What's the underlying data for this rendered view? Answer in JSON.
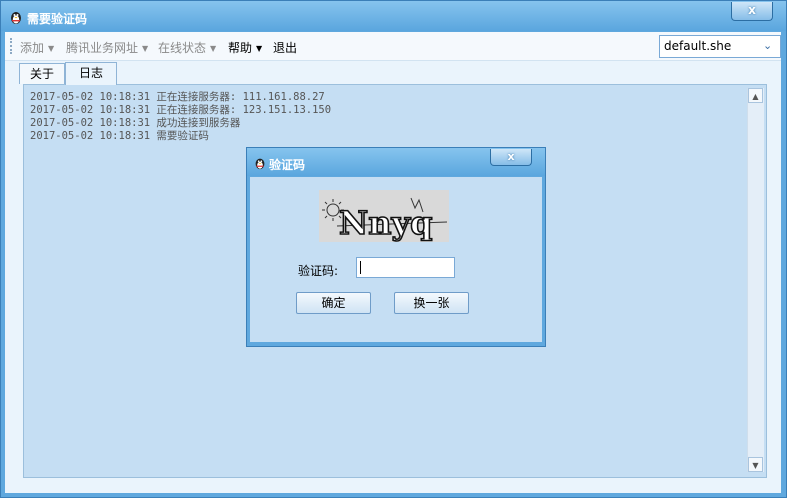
{
  "window": {
    "title": "需要验证码",
    "close_label": "x",
    "icon": "qq-penguin-icon"
  },
  "menubar": {
    "items": [
      {
        "label": "添加",
        "enabled": false,
        "has_arrow": true
      },
      {
        "label": "腾讯业务网址",
        "enabled": false,
        "has_arrow": true
      },
      {
        "label": "在线状态",
        "enabled": false,
        "has_arrow": true
      },
      {
        "label": "帮助",
        "enabled": true,
        "has_arrow": true
      },
      {
        "label": "退出",
        "enabled": true,
        "has_arrow": false
      }
    ],
    "profile_select": {
      "value": "default.she"
    }
  },
  "tabs": [
    {
      "label": "关于",
      "active": false
    },
    {
      "label": "日志",
      "active": true
    }
  ],
  "log": {
    "lines": [
      "2017-05-02 10:18:31 正在连接服务器: 111.161.88.27",
      "2017-05-02 10:18:31 正在连接服务器: 123.151.13.150",
      "2017-05-02 10:18:31 成功连接到服务器",
      "2017-05-02 10:18:31 需要验证码"
    ]
  },
  "dialog": {
    "title": "验证码",
    "close_label": "x",
    "captcha_text": "Nnyq",
    "field_label": "验证码:",
    "field_value": "",
    "ok_label": "确定",
    "refresh_label": "换一张"
  },
  "colors": {
    "window_frame": "#5fa8de",
    "client_bg": "#eaf4fc",
    "pane_bg": "#c5def3"
  }
}
